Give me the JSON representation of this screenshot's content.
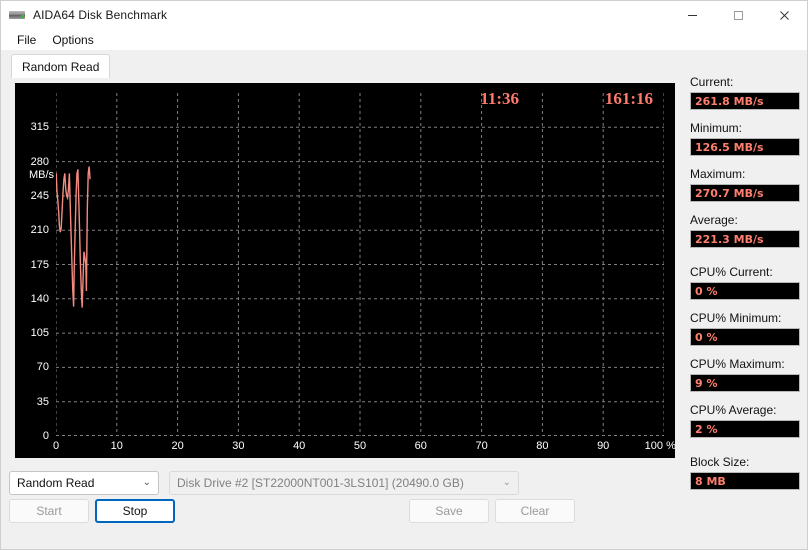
{
  "window": {
    "title": "AIDA64 Disk Benchmark",
    "icon": "hard-drive-icon",
    "minimize": "—",
    "maximize": "☐",
    "close": "✕"
  },
  "menu": {
    "items": [
      {
        "label": "File"
      },
      {
        "label": "Options"
      }
    ]
  },
  "tabs": [
    {
      "label": "Random Read",
      "active": true
    }
  ],
  "chart_data": {
    "type": "line",
    "title": "",
    "xlabel": "100 %",
    "ylabel": "MB/s",
    "xlim": [
      0,
      100
    ],
    "ylim": [
      0,
      350
    ],
    "grid": true,
    "legend": "none",
    "x_ticks": [
      "0",
      "10",
      "20",
      "30",
      "40",
      "50",
      "60",
      "70",
      "80",
      "90",
      "100 %"
    ],
    "x_tick_values": [
      0,
      10,
      20,
      30,
      40,
      50,
      60,
      70,
      80,
      90,
      100
    ],
    "y_ticks": [
      "0",
      "35",
      "70",
      "105",
      "140",
      "175",
      "210",
      "245",
      "280",
      "315"
    ],
    "y_tick_values": [
      0,
      35,
      70,
      105,
      140,
      175,
      210,
      245,
      280,
      315
    ],
    "unit_label": "MB/s",
    "line_color": "#f58a80",
    "background": "#000000",
    "grid_color": "#808080",
    "series": [
      {
        "name": "Random Read",
        "x": [
          0.05,
          0.15,
          0.3,
          0.45,
          0.55,
          0.7,
          0.85,
          1.0,
          1.15,
          1.3,
          1.45,
          1.6,
          1.75,
          1.9,
          2.05,
          2.2,
          2.3,
          2.45,
          2.6,
          2.75,
          2.9,
          3.0,
          3.15,
          3.3,
          3.45,
          3.6,
          3.75,
          3.9,
          4.0,
          4.15,
          4.3,
          4.45,
          4.6,
          4.75,
          4.9,
          5.0,
          5.15,
          5.3,
          5.45,
          5.6
        ],
        "values": [
          268,
          250,
          240,
          228,
          215,
          208,
          212,
          230,
          248,
          262,
          268,
          252,
          245,
          243,
          252,
          268,
          245,
          212,
          180,
          150,
          132,
          172,
          210,
          245,
          268,
          272,
          240,
          205,
          178,
          150,
          131,
          160,
          188,
          182,
          176,
          148,
          232,
          268,
          275,
          262
        ]
      }
    ],
    "timers": {
      "elapsed": "11:36",
      "total": "161:16"
    }
  },
  "controls": {
    "mode_select": {
      "value": "Random Read",
      "chevron": "⌄"
    },
    "drive_select": {
      "value": "Disk Drive #2  [ST22000NT001-3LS101]  (20490.0 GB)",
      "chevron": "⌄",
      "disabled": true
    },
    "buttons": [
      {
        "name": "start-button",
        "label": "Start",
        "disabled": true,
        "focused": false
      },
      {
        "name": "stop-button",
        "label": "Stop",
        "disabled": false,
        "focused": true
      },
      {
        "name": "save-button",
        "label": "Save",
        "disabled": true,
        "focused": false
      },
      {
        "name": "clear-button",
        "label": "Clear",
        "disabled": true,
        "focused": false
      }
    ]
  },
  "stats": [
    {
      "label": "Current:",
      "value": "261.8 MB/s",
      "gap": false
    },
    {
      "label": "Minimum:",
      "value": "126.5 MB/s",
      "gap": false
    },
    {
      "label": "Maximum:",
      "value": "270.7 MB/s",
      "gap": false
    },
    {
      "label": "Average:",
      "value": "221.3 MB/s",
      "gap": true
    },
    {
      "label": "CPU% Current:",
      "value": "0 %",
      "gap": false
    },
    {
      "label": "CPU% Minimum:",
      "value": "0 %",
      "gap": false
    },
    {
      "label": "CPU% Maximum:",
      "value": "9 %",
      "gap": false
    },
    {
      "label": "CPU% Average:",
      "value": "2 %",
      "gap": true
    },
    {
      "label": "Block Size:",
      "value": "8 MB",
      "gap": false
    }
  ],
  "colors": {
    "accent": "#0067c0",
    "value_text": "#ff7f6e",
    "trace": "#f58a80",
    "panel_bg": "#000000"
  }
}
